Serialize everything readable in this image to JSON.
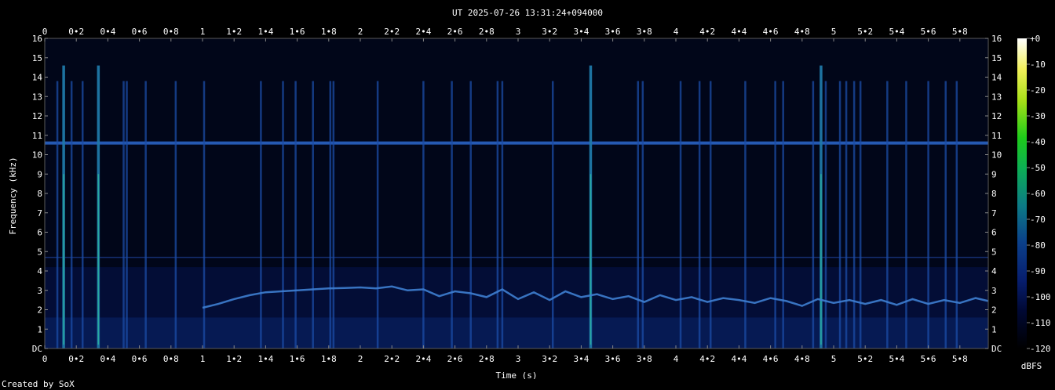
{
  "chart_data": {
    "type": "heatmap",
    "title": "UT 2025-07-26 13:31:24+094000",
    "xlabel": "Time (s)",
    "ylabel": "Frequency (kHz)",
    "xlim": [
      0,
      5.98
    ],
    "ylim": [
      0,
      16
    ],
    "x_ticks": [
      "0",
      "0•2",
      "0•4",
      "0•6",
      "0•8",
      "1",
      "1•2",
      "1•4",
      "1•6",
      "1•8",
      "2",
      "2•2",
      "2•4",
      "2•6",
      "2•8",
      "3",
      "3•2",
      "3•4",
      "3•6",
      "3•8",
      "4",
      "4•2",
      "4•4",
      "4•6",
      "4•8",
      "5",
      "5•2",
      "5•4",
      "5•6",
      "5•8"
    ],
    "x_tick_values": [
      0,
      0.2,
      0.4,
      0.6,
      0.8,
      1,
      1.2,
      1.4,
      1.6,
      1.8,
      2,
      2.2,
      2.4,
      2.6,
      2.8,
      3,
      3.2,
      3.4,
      3.6,
      3.8,
      4,
      4.2,
      4.4,
      4.6,
      4.8,
      5,
      5.2,
      5.4,
      5.6,
      5.8
    ],
    "y_ticks": [
      "DC",
      "1",
      "2",
      "3",
      "4",
      "5",
      "6",
      "7",
      "8",
      "9",
      "10",
      "11",
      "12",
      "13",
      "14",
      "15",
      "16"
    ],
    "y_tick_values": [
      0,
      1,
      2,
      3,
      4,
      5,
      6,
      7,
      8,
      9,
      10,
      11,
      12,
      13,
      14,
      15,
      16
    ],
    "colorbar": {
      "label": "dBFS",
      "ticks": [
        "+0",
        "-10",
        "-20",
        "-30",
        "-40",
        "-50",
        "-60",
        "-70",
        "-80",
        "-90",
        "-100",
        "-110",
        "-120"
      ],
      "tick_values": [
        0,
        -10,
        -20,
        -30,
        -40,
        -50,
        -60,
        -70,
        -80,
        -90,
        -100,
        -110,
        -120
      ],
      "range": [
        -120,
        0
      ]
    },
    "features": {
      "horizontal_tone_khz": 10.6,
      "faint_tone_khz": 4.7,
      "strong_clicks_s": [
        0.12,
        0.34,
        3.46,
        4.92
      ],
      "clicks_s": [
        0.08,
        0.17,
        0.24,
        0.5,
        0.52,
        0.64,
        0.83,
        1.01,
        1.37,
        1.51,
        1.59,
        1.7,
        1.81,
        1.83,
        2.11,
        2.4,
        2.58,
        2.7,
        2.87,
        2.9,
        3.22,
        3.76,
        3.79,
        4.03,
        4.15,
        4.22,
        4.44,
        4.63,
        4.68,
        4.87,
        4.95,
        5.04,
        5.08,
        5.13,
        5.17,
        5.34,
        5.46,
        5.6,
        5.71,
        5.78
      ],
      "whistle_contour": {
        "t": [
          1.0,
          1.1,
          1.2,
          1.3,
          1.4,
          1.5,
          1.6,
          1.7,
          1.8,
          1.9,
          2.0,
          2.1,
          2.2,
          2.3,
          2.4,
          2.5,
          2.6,
          2.7,
          2.8,
          2.9,
          3.0,
          3.1,
          3.2,
          3.3,
          3.4,
          3.5,
          3.6,
          3.7,
          3.8,
          3.9,
          4.0,
          4.1,
          4.2,
          4.3,
          4.4,
          4.5,
          4.6,
          4.7,
          4.8,
          4.9,
          5.0,
          5.1,
          5.2,
          5.3,
          5.4,
          5.5,
          5.6,
          5.7,
          5.8,
          5.9,
          5.98
        ],
        "khz": [
          2.1,
          2.3,
          2.55,
          2.75,
          2.9,
          2.95,
          3.0,
          3.05,
          3.1,
          3.12,
          3.15,
          3.1,
          3.2,
          3.0,
          3.05,
          2.7,
          2.95,
          2.85,
          2.65,
          3.05,
          2.55,
          2.9,
          2.5,
          2.95,
          2.65,
          2.8,
          2.55,
          2.7,
          2.4,
          2.75,
          2.5,
          2.65,
          2.4,
          2.6,
          2.5,
          2.35,
          2.6,
          2.45,
          2.2,
          2.55,
          2.35,
          2.5,
          2.3,
          2.5,
          2.25,
          2.55,
          2.3,
          2.5,
          2.35,
          2.6,
          2.45
        ]
      }
    }
  },
  "footer": {
    "credit": "Created by SoX"
  }
}
